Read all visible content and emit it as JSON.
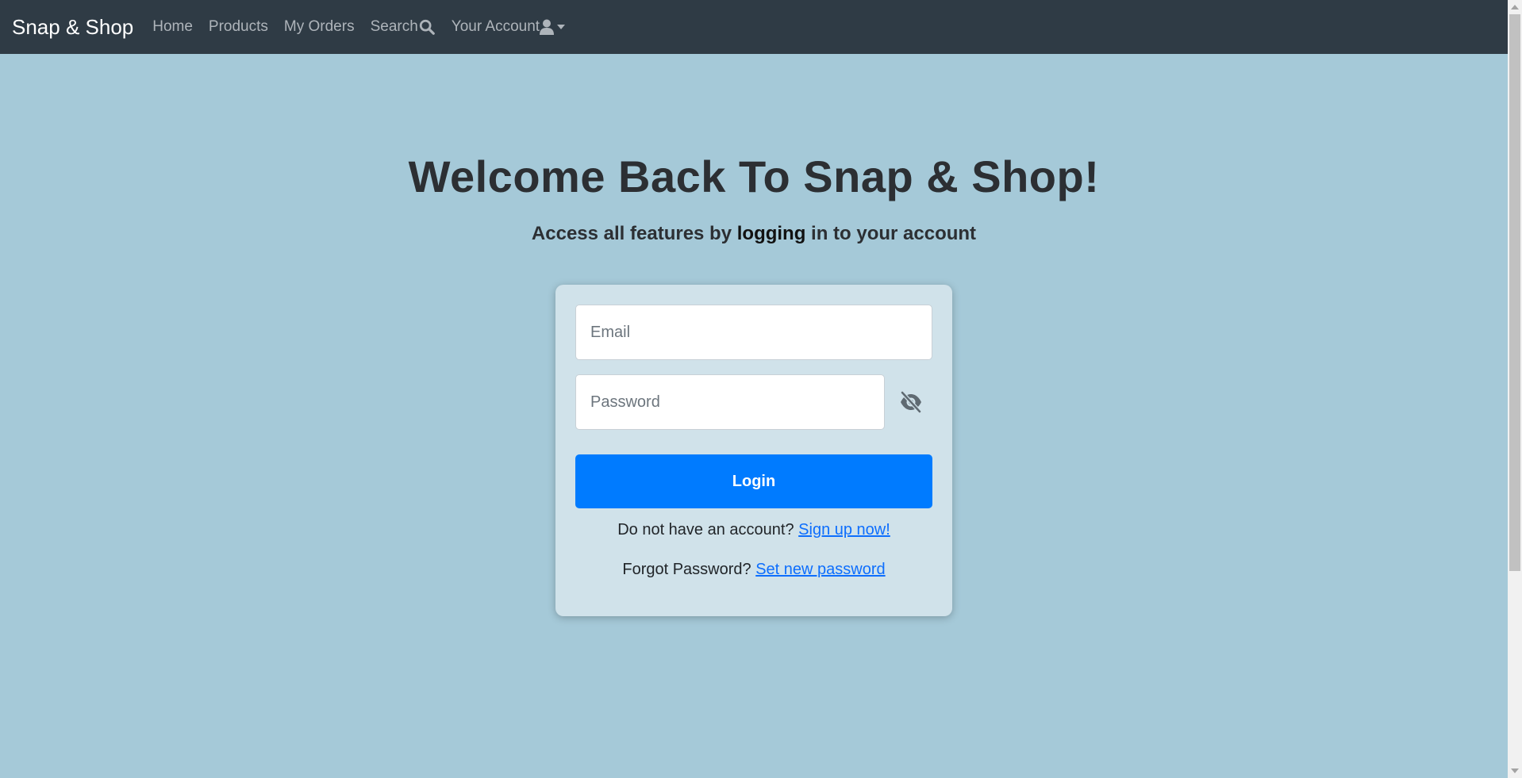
{
  "navbar": {
    "brand": "Snap & Shop",
    "links": {
      "home": "Home",
      "products": "Products",
      "orders": "My Orders",
      "search": "Search",
      "account": "Your Account"
    },
    "background": "#2f3b45"
  },
  "hero": {
    "title": "Welcome Back To Snap & Shop!",
    "subtitle_prefix": "Access all features by ",
    "subtitle_strong": "logging",
    "subtitle_suffix": " in to your account"
  },
  "login_form": {
    "email_placeholder": "Email",
    "email_value": "",
    "password_placeholder": "Password",
    "password_value": "",
    "password_toggle_icon": "eye-slash-icon",
    "login_label": "Login",
    "signup_prompt": "Do not have an account? ",
    "signup_link": "Sign up now!",
    "forgot_prompt": "Forgot Password? ",
    "forgot_link": "Set new password"
  },
  "colors": {
    "page_background": "#a5c9d8",
    "card_background": "#d0e2ea",
    "primary": "#007bff",
    "link": "#0d6efd"
  }
}
